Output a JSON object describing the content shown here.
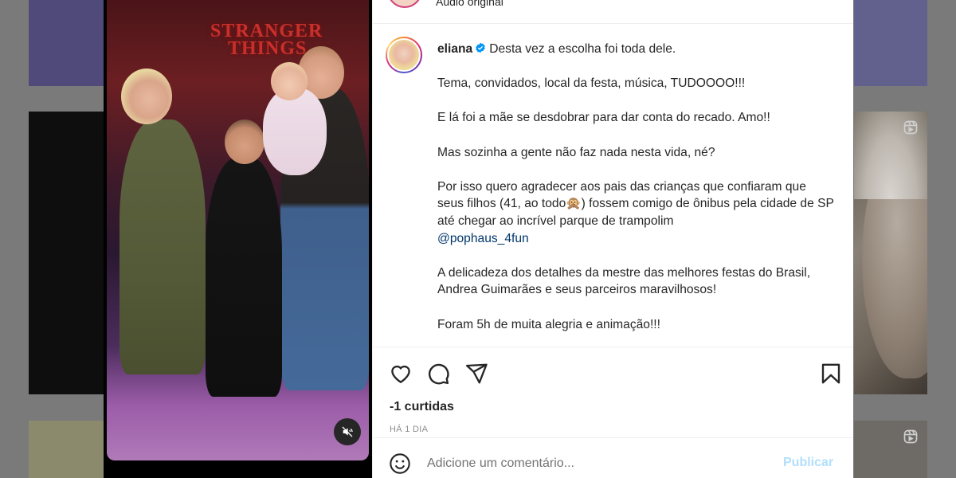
{
  "post": {
    "audio_label": "Áudio original",
    "username": "eliana",
    "caption_first": "Desta vez a escolha foi toda dele.",
    "paragraphs": [
      "Tema, convidados, local da festa, música, TUDOOOO!!!",
      "E lá foi a mãe se desdobrar para dar conta do recado. Amo!!",
      "Mas sozinha a gente não faz nada nesta vida, né?"
    ],
    "thanks_text": "Por isso quero agradecer aos pais das crianças que confiaram que seus filhos (41, ao todo🙊) fossem comigo de ônibus pela cidade de SP até chegar ao incrível parque de trampolim",
    "mention": "@pophaus_4fun",
    "paragraphs_after": [
      "A delicadeza dos detalhes da mestre das melhores festas do Brasil, Andrea Guimarães e seus parceiros maravilhosos!",
      "Foram 5h de muita alegria e animação!!!"
    ],
    "likes_text": "-1 curtidas",
    "date_text": "HÁ 1 DIA",
    "media_sign_line1": "STRANGER",
    "media_sign_line2": "THINGS"
  },
  "comment_box": {
    "placeholder": "Adicione um comentário...",
    "publish_label": "Publicar"
  },
  "icons": {
    "like": "heart-icon",
    "comment": "comment-icon",
    "share": "paper-plane-icon",
    "save": "bookmark-icon",
    "emoji": "smiley-icon",
    "mute": "speaker-muted-icon",
    "reel": "reels-icon",
    "verified": "verified-badge-icon"
  },
  "colors": {
    "verified": "#0095f6",
    "mention": "#00376b",
    "publish_disabled": "#b2dffc",
    "secondary_text": "#8e8e8e"
  }
}
